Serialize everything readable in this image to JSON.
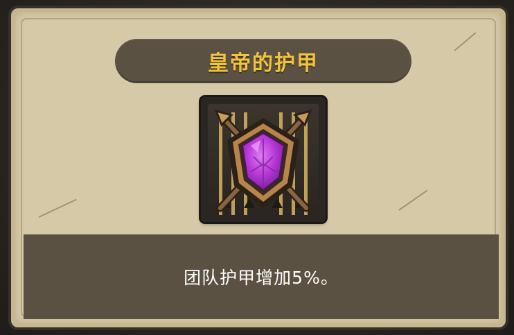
{
  "item": {
    "name": "皇帝的护甲",
    "description": "团队护甲增加5%。"
  },
  "icon": {
    "name": "imperial-shield-crossed-spears-icon",
    "gem_color": "#b636d6"
  },
  "colors": {
    "title_text": "#f2c33b",
    "panel_bg": "#5b5142",
    "card_bg": "#d6c9a7"
  }
}
